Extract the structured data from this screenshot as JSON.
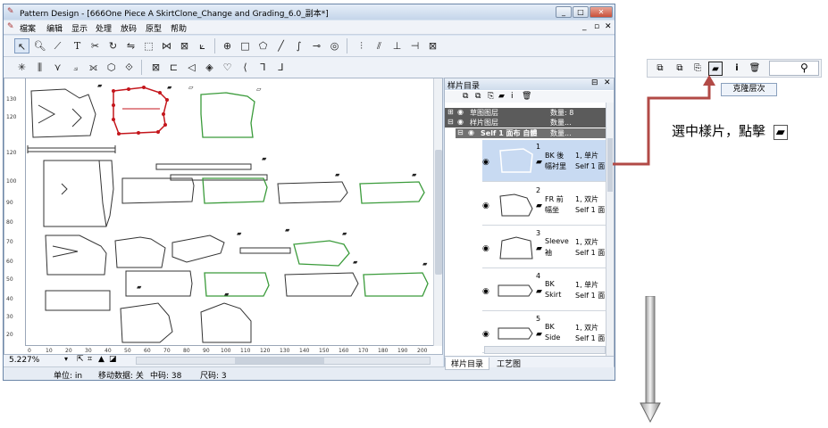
{
  "window": {
    "title": "Pattern Design - [666One Piece A SkirtClone_Change and Grading_6.0_副本*]",
    "controls": [
      "_",
      "□",
      "✕"
    ],
    "mdi_controls": [
      "_",
      "▫",
      "✕"
    ]
  },
  "menu": [
    "檔案",
    "编辑",
    "显示",
    "处理",
    "放码",
    "原型",
    "帮助"
  ],
  "toolbar_icons": {
    "row1": [
      "select-arrow",
      "zoom",
      "ruler",
      "text",
      "cut",
      "rotate",
      "mirror",
      "grade",
      "align",
      "transform",
      "point",
      "rectangle",
      "polygon",
      "line",
      "curve",
      "notch",
      "spiral",
      "vertical-align",
      "fold",
      "dimension",
      "move-point"
    ],
    "row2": [
      "dart",
      "pleat",
      "seam",
      "fullness",
      "flip",
      "split",
      "grain",
      "marker",
      "tuck",
      "button",
      "buttonhole",
      "hem",
      "corner"
    ]
  },
  "ruler": {
    "vertical": [
      "130",
      "120",
      "110",
      "100",
      "90",
      "80",
      "70",
      "60",
      "50",
      "40",
      "30",
      "20",
      "10",
      "0"
    ],
    "horizontal": [
      "0",
      "10",
      "20",
      "30",
      "40",
      "50",
      "60",
      "70",
      "80",
      "90",
      "100",
      "110",
      "120",
      "130",
      "140",
      "150",
      "160",
      "170",
      "180",
      "190",
      "200"
    ]
  },
  "zoom": "5.227%",
  "status": {
    "unit": "单位: in",
    "move_data": "移动数据: 关",
    "mid_size": "中码: 38",
    "size": "尺码: 3"
  },
  "panel": {
    "title": "样片目录",
    "layers": [
      {
        "name": "草图图层",
        "count": "数量: 8"
      },
      {
        "name": "样片图层",
        "count": "数量..."
      },
      {
        "name": "Self 1 面布 自體",
        "count": "数量..."
      }
    ],
    "pieces": [
      {
        "num": "1",
        "name1": "BK 後",
        "name2": "幅衬里",
        "qty1": "1, 单片",
        "qty2": "Self 1 面",
        "selected": true
      },
      {
        "num": "2",
        "name1": "FR 前",
        "name2": "幅坐",
        "qty1": "1, 双片",
        "qty2": "Self 1 面",
        "selected": false
      },
      {
        "num": "3",
        "name1": "Sleeve",
        "name2": "袖",
        "qty1": "1, 双片",
        "qty2": "Self 1 面",
        "selected": false
      },
      {
        "num": "4",
        "name1": "BK",
        "name2": "Skirt",
        "qty1": "1, 单片",
        "qty2": "Self 1 面",
        "selected": false
      },
      {
        "num": "5",
        "name1": "BK",
        "name2": "Side",
        "qty1": "1, 双片",
        "qty2": "Self 1 面",
        "selected": false
      }
    ],
    "tabs": [
      "样片目录",
      "工艺图"
    ]
  },
  "callout": {
    "tooltip": "克隆层次",
    "instruction": "選中樣片，點擊",
    "toolbar_icons": [
      "new-piece-icon",
      "copy-piece-icon",
      "duplicate-piece-icon",
      "clone-layer-icon",
      "info-icon",
      "delete-icon",
      "search-icon"
    ]
  },
  "colors": {
    "selected_piece": "#c4161c",
    "graded_piece": "#3a9b3a",
    "arrow": "#c0504d"
  }
}
